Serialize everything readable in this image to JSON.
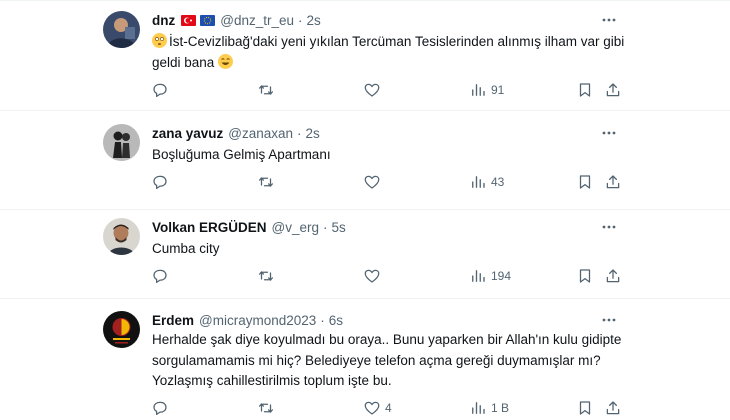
{
  "tweets": [
    {
      "name": "dnz",
      "handle": "@dnz_tr_eu",
      "time": "2s",
      "text": "İst-Cevizlibağ'daki yeni yıkılan Tercüman Tesislerinden alınmış ilham var gibi geldi bana",
      "views": "91",
      "likes": ""
    },
    {
      "name": "zana yavuz",
      "handle": "@zanaxan",
      "time": "2s",
      "text": "Boşluğuma Gelmiş Apartmanı",
      "views": "43",
      "likes": ""
    },
    {
      "name": "Volkan ERGÜDEN",
      "handle": "@v_erg",
      "time": "5s",
      "text": "Cumba city",
      "views": "194",
      "likes": ""
    },
    {
      "name": "Erdem",
      "handle": "@micraymond2023",
      "time": "6s",
      "text": "Herhalde şak diye koyulmadı bu oraya.. Bunu yaparken bir Allah'ın kulu gidipte sorgulamamamis mi hiç? Belediyeye telefon açma gereği duymamışlar mı? Yozlaşmış cahillestirilmis toplum işte bu.",
      "views": "1 B",
      "likes": "4"
    }
  ],
  "separator": "·",
  "colors": {
    "text": "#0f1419",
    "secondary": "#536471",
    "border": "#eff3f4",
    "emoji": "#ffcc4d"
  },
  "icons": [
    "more-icon",
    "reply-icon",
    "retweet-icon",
    "like-icon",
    "views-icon",
    "bookmark-icon",
    "share-icon"
  ]
}
